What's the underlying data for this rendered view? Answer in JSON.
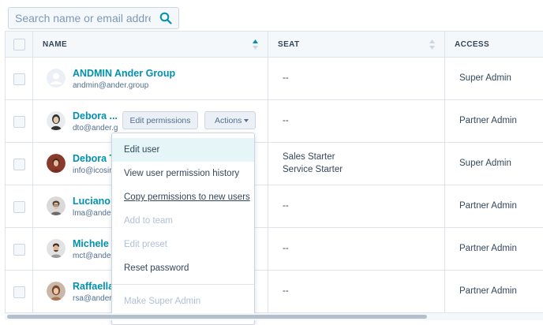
{
  "search": {
    "placeholder": "Search name or email address"
  },
  "table": {
    "headers": {
      "name": "NAME",
      "seat": "SEAT",
      "access": "ACCESS"
    },
    "rows": [
      {
        "name": "ANDMIN Ander Group",
        "email": "andmin@ander.group",
        "seat": [
          "--"
        ],
        "access": "Super Admin"
      },
      {
        "name": "Debora ...",
        "email": "dto@ander.g",
        "seat": [
          "--"
        ],
        "access": "Partner Admin"
      },
      {
        "name": "Debora T",
        "email": "info@icosin",
        "seat": [
          "Sales Starter",
          "Service Starter"
        ],
        "access": "Super Admin"
      },
      {
        "name": "Luciano N",
        "email": "lma@ander.",
        "seat": [
          "--"
        ],
        "access": "Partner Admin"
      },
      {
        "name": "Michele C",
        "email": "mct@ander",
        "seat": [
          "--"
        ],
        "access": "Partner Admin"
      },
      {
        "name": "Raffaella",
        "email": "rsa@ander.",
        "seat": [
          "--"
        ],
        "access": "Partner Admin"
      }
    ]
  },
  "row_buttons": {
    "edit_permissions": "Edit permissions",
    "actions": "Actions"
  },
  "menu": {
    "items": [
      {
        "label": "Edit user",
        "state": "highlighted"
      },
      {
        "label": "View user permission history",
        "state": "enabled"
      },
      {
        "label": "Copy permissions to new users",
        "state": "enabled"
      },
      {
        "label": "Add to team",
        "state": "disabled"
      },
      {
        "label": "Edit preset",
        "state": "disabled"
      },
      {
        "label": "Reset password",
        "state": "enabled"
      },
      {
        "label": "Make Super Admin",
        "state": "disabled"
      }
    ]
  },
  "colors": {
    "link": "#0091ae",
    "text": "#33475b",
    "border": "#dfe3eb",
    "header_bg": "#f5f8fa",
    "menu_highlight": "#e5f5f8",
    "disabled": "#b0c1d4"
  },
  "icons": {
    "search": "search-icon",
    "sort": "sort-icon",
    "caret": "caret-down-icon",
    "avatar_default": "default-avatar-icon"
  }
}
